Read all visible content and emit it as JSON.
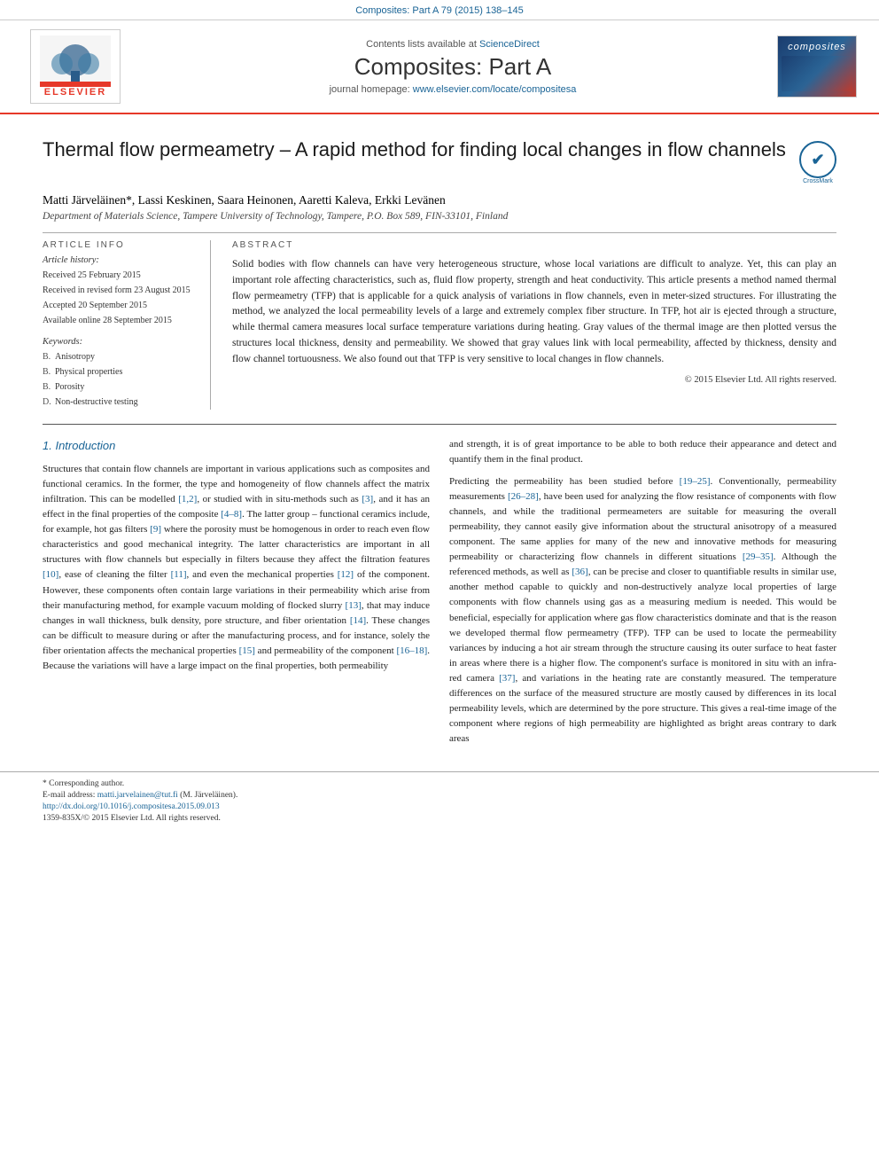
{
  "topbar": {
    "citation": "Composites: Part A 79 (2015) 138–145"
  },
  "journal_header": {
    "sciencedirect_text": "Contents lists available at ",
    "sciencedirect_link": "ScienceDirect",
    "journal_title": "Composites: Part A",
    "homepage_text": "journal homepage: ",
    "homepage_url": "www.elsevier.com/locate/compositesa",
    "elsevier_label": "ELSEVIER",
    "composites_logo_text": "composites"
  },
  "article": {
    "title": "Thermal flow permeametry – A rapid method for finding local changes in flow channels",
    "crossmark_label": "CrossMark",
    "authors": "Matti Järveläinen*, Lassi Keskinen, Saara Heinonen, Aaretti Kaleva, Erkki Levänen",
    "affiliation": "Department of Materials Science, Tampere University of Technology, Tampere, P.O. Box 589, FIN-33101, Finland"
  },
  "article_info": {
    "section_title": "ARTICLE INFO",
    "history_title": "Article history:",
    "received": "Received 25 February 2015",
    "revised": "Received in revised form 23 August 2015",
    "accepted": "Accepted 20 September 2015",
    "available": "Available online 28 September 2015",
    "keywords_title": "Keywords:",
    "keyword1_letter": "B.",
    "keyword1": "Anisotropy",
    "keyword2_letter": "B.",
    "keyword2": "Physical properties",
    "keyword3_letter": "B.",
    "keyword3": "Porosity",
    "keyword4_letter": "D.",
    "keyword4": "Non-destructive testing"
  },
  "abstract": {
    "title": "ABSTRACT",
    "text": "Solid bodies with flow channels can have very heterogeneous structure, whose local variations are difficult to analyze. Yet, this can play an important role affecting characteristics, such as, fluid flow property, strength and heat conductivity. This article presents a method named thermal flow permeametry (TFP) that is applicable for a quick analysis of variations in flow channels, even in meter-sized structures. For illustrating the method, we analyzed the local permeability levels of a large and extremely complex fiber structure. In TFP, hot air is ejected through a structure, while thermal camera measures local surface temperature variations during heating. Gray values of the thermal image are then plotted versus the structures local thickness, density and permeability. We showed that gray values link with local permeability, affected by thickness, density and flow channel tortuousness. We also found out that TFP is very sensitive to local changes in flow channels.",
    "copyright": "© 2015 Elsevier Ltd. All rights reserved."
  },
  "body": {
    "section1_heading": "1. Introduction",
    "col1_para1": "Structures that contain flow channels are important in various applications such as composites and functional ceramics. In the former, the type and homogeneity of flow channels affect the matrix infiltration. This can be modelled [1,2], or studied with in situ-methods such as [3], and it has an effect in the final properties of the composite [4–8]. The latter group – functional ceramics include, for example, hot gas filters [9] where the porosity must be homogenous in order to reach even flow characteristics and good mechanical integrity. The latter characteristics are important in all structures with flow channels but especially in filters because they affect the filtration features [10], ease of cleaning the filter [11], and even the mechanical properties [12] of the component. However, these components often contain large variations in their permeability which arise from their manufacturing method, for example vacuum molding of flocked slurry [13], that may induce changes in wall thickness, bulk density, pore structure, and fiber orientation [14]. These changes can be difficult to measure during or after the manufacturing process, and for instance, solely the fiber orientation affects the mechanical properties [15] and permeability of the component [16–18]. Because the variations will have a large impact on the final properties, both permeability",
    "col2_para1": "and strength, it is of great importance to be able to both reduce their appearance and detect and quantify them in the final product.",
    "col2_para2": "Predicting the permeability has been studied before [19–25]. Conventionally, permeability measurements [26–28], have been used for analyzing the flow resistance of components with flow channels, and while the traditional permeameters are suitable for measuring the overall permeability, they cannot easily give information about the structural anisotropy of a measured component. The same applies for many of the new and innovative methods for measuring permeability or characterizing flow channels in different situations [29–35]. Although the referenced methods, as well as [36], can be precise and closer to quantifiable results in similar use, another method capable to quickly and non-destructively analyze local properties of large components with flow channels using gas as a measuring medium is needed. This would be beneficial, especially for application where gas flow characteristics dominate and that is the reason we developed thermal flow permeametry (TFP). TFP can be used to locate the permeability variances by inducing a hot air stream through the structure causing its outer surface to heat faster in areas where there is a higher flow. The component's surface is monitored in situ with an infra-red camera [37], and variations in the heating rate are constantly measured. The temperature differences on the surface of the measured structure are mostly caused by differences in its local permeability levels, which are determined by the pore structure. This gives a real-time image of the component where regions of high permeability are highlighted as bright areas contrary to dark areas"
  },
  "footer": {
    "corresponding_author": "* Corresponding author.",
    "email_label": "E-mail address: ",
    "email": "matti.jarvelainen@tut.fi",
    "email_suffix": " (M. Järveläinen).",
    "doi": "http://dx.doi.org/10.1016/j.compositesa.2015.09.013",
    "issn": "1359-835X/© 2015 Elsevier Ltd. All rights reserved."
  }
}
